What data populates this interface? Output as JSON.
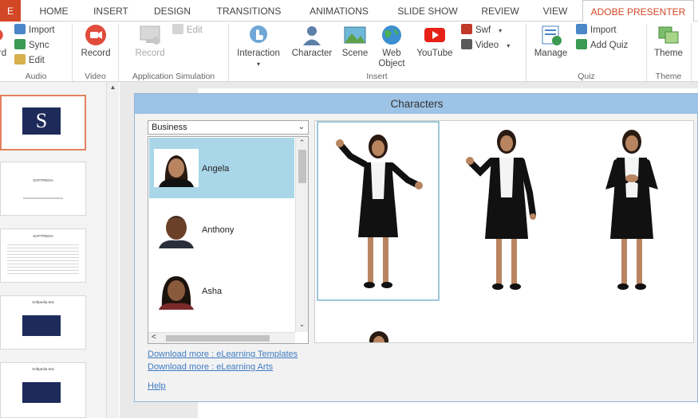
{
  "tabs": [
    {
      "label": "E"
    },
    {
      "label": "HOME"
    },
    {
      "label": "INSERT"
    },
    {
      "label": "DESIGN"
    },
    {
      "label": "TRANSITIONS"
    },
    {
      "label": "ANIMATIONS"
    },
    {
      "label": "SLIDE SHOW"
    },
    {
      "label": "REVIEW"
    },
    {
      "label": "VIEW"
    },
    {
      "label": "ADOBE PRESENTER"
    }
  ],
  "ribbon": {
    "audio": {
      "label": "Audio",
      "cut_label": "rd",
      "import_label": "Import",
      "sync_label": "Sync",
      "edit_label": "Edit"
    },
    "video": {
      "label": "Video",
      "record_label": "Record"
    },
    "appsim": {
      "label": "Application Simulation",
      "record_label": "Record",
      "edit_label": "Edit"
    },
    "insert": {
      "label": "Insert",
      "interaction_label": "Interaction",
      "character_label": "Character",
      "scene_label": "Scene",
      "web_label": "Web",
      "object_label": "Object",
      "youtube_label": "YouTube",
      "swf_label": "Swf",
      "video_label": "Video"
    },
    "quiz": {
      "label": "Quiz",
      "manage_label": "Manage",
      "import_label": "Import",
      "addquiz_label": "Add Quiz"
    },
    "theme": {
      "label": "Theme",
      "theme_label": "Theme"
    }
  },
  "slides": {
    "s1_letter": "S",
    "s2_title": "SOFTPEDIA",
    "s3_title": "SOFTPEDIA",
    "s4_title": "Softpedia test",
    "s5_title": "Softpedia test"
  },
  "dialog": {
    "title": "Characters",
    "category": "Business",
    "characters": [
      "Angela",
      "Anthony",
      "Asha"
    ],
    "links": [
      "Download more : eLearning Templates",
      "Download more : eLearning Arts"
    ],
    "help_label": "Help"
  },
  "colors": {
    "accent": "#d24726",
    "dialog_title_bg": "#9dc3e6",
    "selected_item": "#a9d6e8",
    "slide_navy": "#1d2a5a"
  }
}
